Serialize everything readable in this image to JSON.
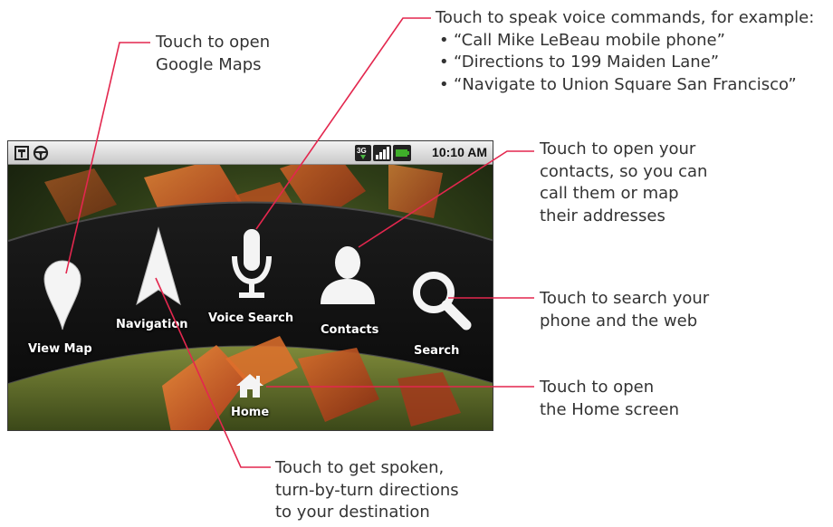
{
  "callouts": {
    "maps": {
      "line1": "Touch to open",
      "line2": "Google Maps"
    },
    "voice": {
      "intro": "Touch to speak voice commands, for example:",
      "examples": [
        "“Call Mike LeBeau mobile phone”",
        "“Directions to 199 Maiden Lane”",
        "“Navigate to Union Square San Francisco”"
      ]
    },
    "contacts": {
      "lines": [
        "Touch to open your",
        "contacts, so you can",
        "call them or map",
        "their addresses"
      ]
    },
    "search": {
      "lines": [
        "Touch to search your",
        "phone and the web"
      ]
    },
    "home": {
      "lines": [
        "Touch to open",
        "the Home screen"
      ]
    },
    "navigation": {
      "lines": [
        "Touch to get spoken,",
        "turn-by-turn directions",
        "to your destination"
      ]
    }
  },
  "status_bar": {
    "time": "10:10 AM",
    "network": "3G",
    "icons": [
      "notification-icon",
      "steering-wheel-icon",
      "3g-icon",
      "signal-icon",
      "battery-icon"
    ]
  },
  "dock": {
    "view_map": "View Map",
    "navigation": "Navigation",
    "voice_search": "Voice Search",
    "contacts": "Contacts",
    "search": "Search",
    "home": "Home"
  },
  "colors": {
    "leader_line": "#e3274e",
    "callout_text": "#333333",
    "battery": "#3fae2a"
  }
}
